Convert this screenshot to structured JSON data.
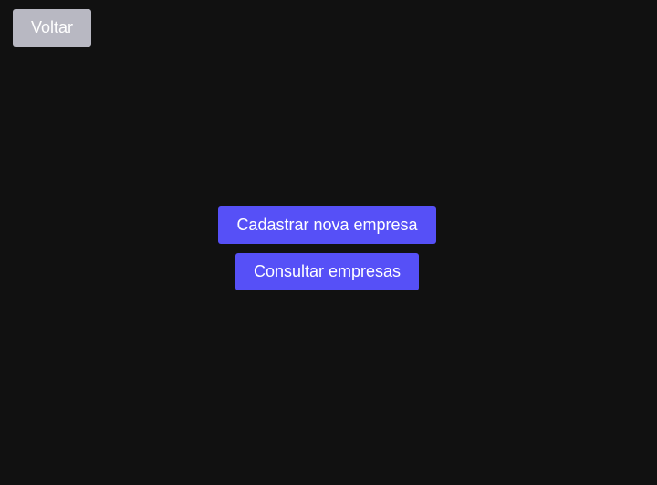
{
  "header": {
    "back_label": "Voltar"
  },
  "main": {
    "register_company_label": "Cadastrar nova empresa",
    "list_companies_label": "Consultar empresas"
  },
  "colors": {
    "background": "#111111",
    "back_button": "#b8b8c2",
    "primary_button": "#5650f7",
    "button_text": "#ffffff"
  }
}
